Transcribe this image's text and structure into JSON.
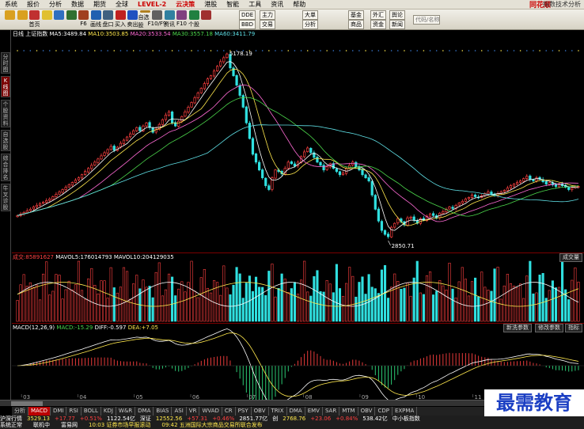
{
  "menu": {
    "items": [
      "系统",
      "报价",
      "分析",
      "数据",
      "期货",
      "全球",
      "LEVEL-2",
      "云决策",
      "港股",
      "智能",
      "工具",
      "资讯",
      "帮助"
    ],
    "logo": "同花顺",
    "page_title": "指数技术分析"
  },
  "toolbar": {
    "buttons": [
      {
        "label": "",
        "icon": "back-icon"
      },
      {
        "label": "",
        "icon": "forward-icon"
      },
      {
        "label": "首页",
        "icon": "home-icon"
      },
      {
        "label": "",
        "icon": "star-icon"
      },
      {
        "label": "",
        "icon": "refresh-icon"
      },
      {
        "label": "",
        "icon": "tv-icon"
      },
      {
        "label": "F6",
        "icon": "bars-icon"
      },
      {
        "label": "画线",
        "icon": "pen-icon"
      },
      {
        "label": "盘口",
        "icon": "dish-icon"
      },
      {
        "label": "买入",
        "icon": "buy-icon"
      },
      {
        "label": "卖出",
        "icon": "sell-icon"
      },
      {
        "label": "自选股",
        "icon": "list-icon"
      },
      {
        "label": "F10/F9",
        "icon": "doc-icon"
      },
      {
        "label": "资讯",
        "icon": "info-icon"
      },
      {
        "label": "F10",
        "icon": "grid-icon"
      },
      {
        "label": "个股",
        "icon": "stock-icon"
      },
      {
        "label": "",
        "icon": "chart-icon"
      }
    ],
    "dde_label": "DDE",
    "bbd_label": "BBD",
    "zhuli_label": "主力",
    "dadan_label": "大单",
    "jijin_label": "基金",
    "waihui_label": "外汇",
    "yulun_label": "舆论",
    "shangpin_label": "商品",
    "xinwen_label": "新闻",
    "ziji_label": "资金",
    "jiaoyi_label": "交易",
    "fenxi_label": "分析",
    "search_placeholder": "代码/名称"
  },
  "sidebar": {
    "tabs": [
      "分时图",
      "K线图",
      "个股资料",
      "自选股",
      "综合排名",
      "牛叉诊股"
    ],
    "active": 1
  },
  "kline": {
    "period": "日线",
    "name": "上证指数",
    "ma": [
      {
        "label": "MA5:",
        "value": "3489.84",
        "color": "#ffffff"
      },
      {
        "label": "MA10:",
        "value": "3503.85",
        "color": "#ffe84d"
      },
      {
        "label": "MA20:",
        "value": "3533.54",
        "color": "#ff6ad5"
      },
      {
        "label": "MA30:",
        "value": "3557.18",
        "color": "#4cd84c"
      },
      {
        "label": "MA60:",
        "value": "3411.79",
        "color": "#5fe0e6"
      }
    ],
    "high_label": "5178.19",
    "low_label": "2850.71"
  },
  "volume": {
    "label": "成交:",
    "value": "85891627",
    "mavol5_label": "MAVOL5:",
    "mavol5": "176014793",
    "mavol10_label": "MAVOL10:",
    "mavol10": "204129035",
    "button": "成交量"
  },
  "macd": {
    "label": "MACD(12,26,9)",
    "macd_label": "MACD:",
    "macd": "-15.29",
    "diff_label": "DIFF:",
    "diff": "-0.597",
    "dea_label": "DEA:",
    "dea": "+7.05",
    "btn_params": "新洗参数",
    "btn_modify": "修改参数",
    "btn_index": "指标"
  },
  "date_ticks": [
    "03",
    "04",
    "05",
    "06",
    "07",
    "08",
    "09",
    "10",
    "11",
    "12"
  ],
  "indicator_tabs": [
    "分析",
    "MACD",
    "DMI",
    "RSI",
    "BOLL",
    "KDJ",
    "W&R",
    "DMA",
    "BIAS",
    "ASI",
    "VR",
    "WVAD",
    "CR",
    "PSY",
    "OBV",
    "TRIX",
    "DMA",
    "EMV",
    "SAR",
    "MTM",
    "OBV",
    "CDP",
    "EXPMA"
  ],
  "active_indicator": 1,
  "status": {
    "r1": [
      "沪深行情",
      "3529.13",
      "+17.77",
      "+0.51%",
      "1122.54亿",
      "深证",
      "12552.56",
      "+57.31",
      "+0.46%",
      "2851.77亿",
      "创",
      "2768.76",
      "+23.06",
      "+0.84%",
      "538.42亿",
      "中小板指数"
    ],
    "r2": [
      "系统正常",
      "联机中",
      "富易网",
      "10:03 证券市场早报滚动",
      "09:42 五洲国际大宗商品交易所联合发布"
    ]
  },
  "watermark": "最需教育",
  "chart_data": {
    "type": "candlestick",
    "title": "上证指数",
    "x_ticks": [
      "03",
      "04",
      "05",
      "06",
      "07",
      "08",
      "09",
      "10",
      "11",
      "12"
    ],
    "annotations": [
      {
        "label": "5178.19",
        "kind": "high"
      },
      {
        "label": "2850.71",
        "kind": "low"
      }
    ],
    "closes": [
      3120,
      3140,
      3160,
      3180,
      3200,
      3230,
      3250,
      3270,
      3290,
      3310,
      3330,
      3360,
      3390,
      3420,
      3450,
      3480,
      3510,
      3540,
      3570,
      3600,
      3640,
      3680,
      3720,
      3760,
      3800,
      3840,
      3880,
      3920,
      3960,
      4000,
      3950,
      3990,
      4040,
      4080,
      4120,
      4160,
      4200,
      4240,
      4200,
      4260,
      4300,
      4240,
      4180,
      4220,
      4280,
      4340,
      4400,
      4440,
      4300,
      4260,
      4320,
      4380,
      4440,
      4500,
      4560,
      4620,
      4680,
      4740,
      4800,
      4860,
      4900,
      4960,
      5020,
      5080,
      5130,
      5178,
      5000,
      4900,
      4780,
      4650,
      4500,
      4300,
      4100,
      3900,
      3800,
      3700,
      3600,
      3500,
      3450,
      3600,
      3700,
      3680,
      3650,
      3720,
      3800,
      3780,
      3750,
      3800,
      3870,
      3930,
      3980,
      3920,
      3860,
      3800,
      3760,
      3700,
      3740,
      3780,
      3720,
      3680,
      3640,
      3660,
      3720,
      3760,
      3800,
      3740,
      3700,
      3640,
      3600,
      3560,
      3380,
      3200,
      3050,
      2930,
      2880,
      2850,
      2970,
      3020,
      3080,
      3040,
      3000,
      3090,
      3100,
      3060,
      3020,
      3080,
      3060,
      3110,
      3140,
      3120,
      3090,
      3150,
      3170,
      3200,
      3230,
      3210,
      3250,
      3280,
      3300,
      3330,
      3350,
      3380,
      3360,
      3350,
      3370,
      3400,
      3420,
      3390,
      3380,
      3400,
      3420,
      3440,
      3470,
      3500,
      3520,
      3540,
      3560,
      3590,
      3620,
      3580,
      3560,
      3600,
      3580,
      3550,
      3520,
      3540,
      3510,
      3490,
      3520,
      3500,
      3480,
      3450,
      3470,
      3490,
      3489
    ]
  }
}
